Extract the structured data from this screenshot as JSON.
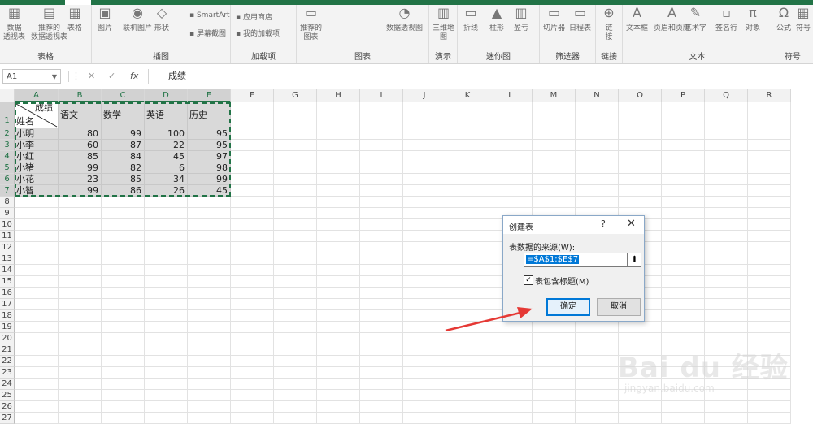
{
  "ribbon": {
    "groups": [
      {
        "label": "表格",
        "buttons": [
          "数据\n透视表",
          "推荐的\n数据透视表",
          "表格"
        ]
      },
      {
        "label": "插图",
        "buttons": [
          "图片",
          "联机图片",
          "形状"
        ],
        "small": [
          "SmartArt",
          "屏幕截图"
        ]
      },
      {
        "label": "加载项",
        "small": [
          "应用商店",
          "我的加载项"
        ]
      },
      {
        "label": "图表",
        "buttons": [
          "推荐的\n图表",
          "数据透视图"
        ]
      },
      {
        "label": "演示",
        "buttons": [
          "三维地\n图"
        ]
      },
      {
        "label": "迷你图",
        "buttons": [
          "折线",
          "柱形",
          "盈亏"
        ]
      },
      {
        "label": "筛选器",
        "buttons": [
          "切片器",
          "日程表"
        ]
      },
      {
        "label": "链接",
        "buttons": [
          "链\n接"
        ]
      },
      {
        "label": "文本",
        "buttons": [
          "文本框",
          "页眉和页脚",
          "艺术字",
          "签名行",
          "对象"
        ]
      },
      {
        "label": "符号",
        "buttons": [
          "公式",
          "符号"
        ]
      }
    ]
  },
  "formula_bar": {
    "name_box": "A1",
    "formula": "成绩"
  },
  "sheet": {
    "columns": [
      "A",
      "B",
      "C",
      "D",
      "E",
      "F",
      "G",
      "H",
      "I",
      "J",
      "K",
      "L",
      "M",
      "N",
      "O",
      "P",
      "Q",
      "R"
    ],
    "rows": [
      "1",
      "2",
      "3",
      "4",
      "5",
      "6",
      "7",
      "8",
      "9",
      "10",
      "11",
      "12",
      "13",
      "14",
      "15",
      "16",
      "17",
      "18",
      "19",
      "20",
      "21",
      "22",
      "23",
      "24",
      "25",
      "26",
      "27"
    ],
    "header_cell": {
      "top": "成绩",
      "bottom": "姓名"
    },
    "headers": [
      "语文",
      "数学",
      "英语",
      "历史"
    ],
    "records": [
      {
        "name": "小明",
        "scores": [
          "80",
          "99",
          "100",
          "95"
        ]
      },
      {
        "name": "小李",
        "scores": [
          "60",
          "87",
          "22",
          "95"
        ]
      },
      {
        "name": "小红",
        "scores": [
          "85",
          "84",
          "45",
          "97"
        ]
      },
      {
        "name": "小猪",
        "scores": [
          "99",
          "82",
          "6",
          "98"
        ]
      },
      {
        "name": "小花",
        "scores": [
          "23",
          "85",
          "34",
          "99"
        ]
      },
      {
        "name": "小智",
        "scores": [
          "99",
          "86",
          "26",
          "45"
        ]
      }
    ]
  },
  "dialog": {
    "title": "创建表",
    "help": "?",
    "close": "✕",
    "source_label": "表数据的来源(W):",
    "range": "=$A$1:$E$7",
    "collapse_icon": "⬆",
    "checkbox_checked": true,
    "checkbox_label": "表包含标题(M)",
    "ok_label": "确定",
    "cancel_label": "取消"
  },
  "watermark": {
    "main": "Bai du 经验",
    "sub": "jingyan.baidu.com"
  },
  "colors": {
    "accent": "#217346",
    "selection_fill": "#d9d9d9",
    "arrow": "#e53935",
    "dialog_focus": "#0078d7"
  }
}
